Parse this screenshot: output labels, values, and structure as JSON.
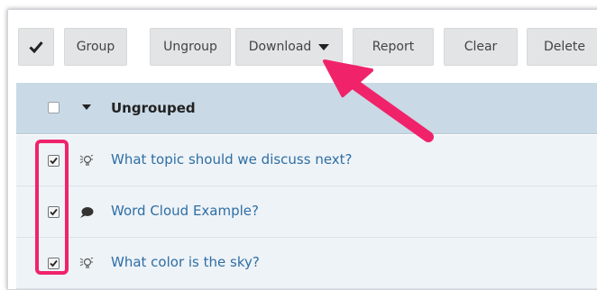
{
  "toolbar": {
    "select_all_icon": "checkmark-icon",
    "buttons": [
      {
        "label": "Group"
      },
      {
        "label": "Ungroup"
      },
      {
        "label": "Download"
      },
      {
        "label": "Report"
      },
      {
        "label": "Clear"
      },
      {
        "label": "Delete"
      }
    ]
  },
  "group": {
    "label": "Ungrouped",
    "checked": false
  },
  "rows": [
    {
      "label": "What topic should we discuss next?",
      "icon": "lightbulb-icon",
      "checked": true
    },
    {
      "label": "Word Cloud Example?",
      "icon": "speech-bubble-icon",
      "checked": true
    },
    {
      "label": "What color is the sky?",
      "icon": "lightbulb-icon",
      "checked": true
    }
  ],
  "colors": {
    "accent_highlight": "#f0236a",
    "link": "#2f6ea4",
    "group_header_bg": "#c9d9e6",
    "row_bg": "#eef3f7"
  }
}
